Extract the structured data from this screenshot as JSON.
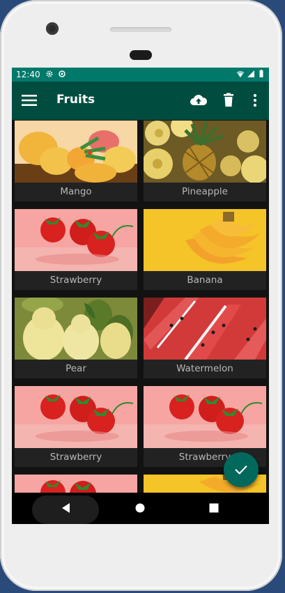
{
  "status": {
    "time": "12:40",
    "icons": [
      "settings-icon",
      "sync-icon",
      "wifi-icon",
      "signal-icon",
      "battery-icon"
    ]
  },
  "appbar": {
    "title": "Fruits",
    "menu_icon": "hamburger-menu-icon",
    "actions": [
      "cloud-upload-icon",
      "delete-icon",
      "more-vert-icon"
    ]
  },
  "fruits": [
    {
      "label": "Mango"
    },
    {
      "label": "Pineapple"
    },
    {
      "label": "Strawberry"
    },
    {
      "label": "Banana"
    },
    {
      "label": "Pear"
    },
    {
      "label": "Watermelon"
    },
    {
      "label": "Strawberry"
    },
    {
      "label": "Strawberry"
    }
  ],
  "fab": {
    "icon": "check-icon"
  },
  "navigation": {
    "buttons": [
      "back-icon",
      "home-icon",
      "recents-icon"
    ]
  },
  "colors": {
    "status_bar": "#00796b",
    "app_bar": "#004d40",
    "fab": "#00695c",
    "background": "#121212"
  }
}
